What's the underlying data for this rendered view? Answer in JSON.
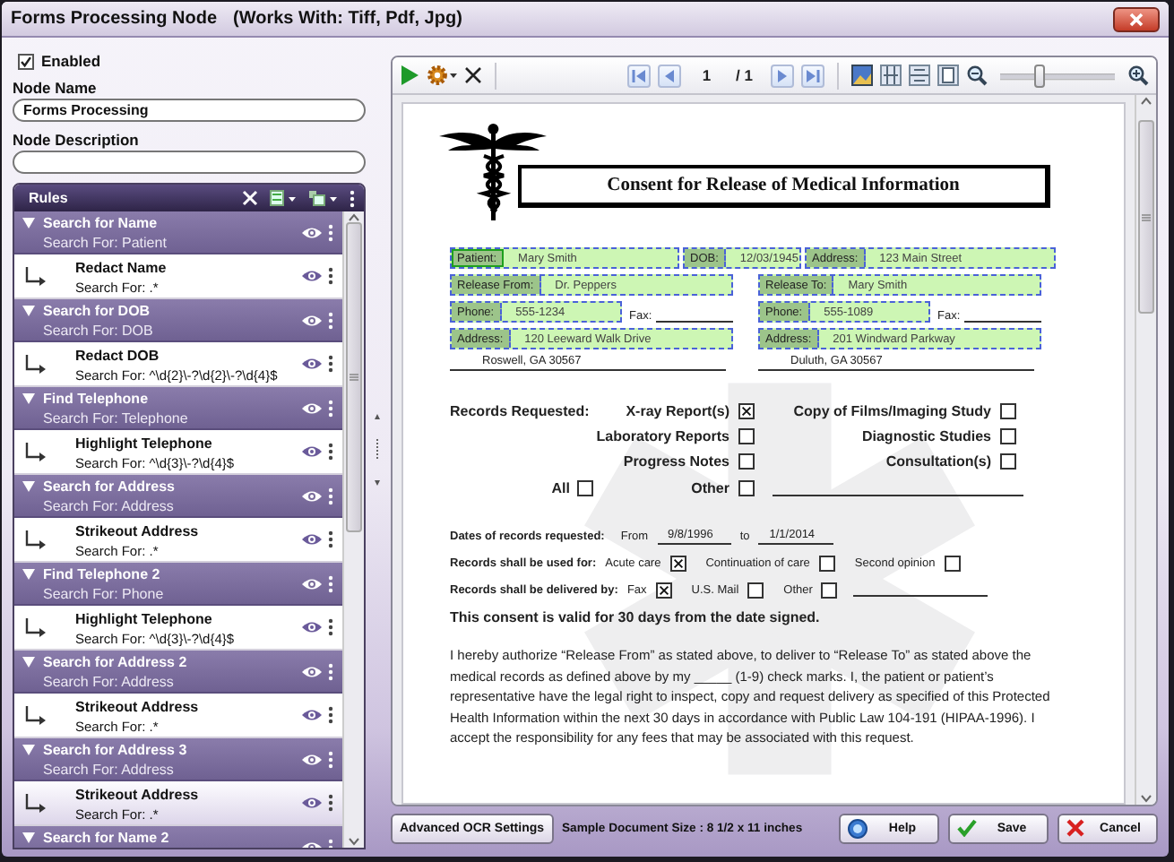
{
  "window": {
    "title": "Forms Processing Node",
    "subtitle": "(Works With: Tiff, Pdf, Jpg)"
  },
  "enabled": {
    "label": "Enabled",
    "checked": true
  },
  "node_name": {
    "label": "Node Name",
    "value": "Forms Processing"
  },
  "node_description": {
    "label": "Node Description"
  },
  "rules": {
    "title": "Rules",
    "groups": [
      {
        "name": "Search for Name",
        "search_for": "Search For: Patient",
        "expanded": true,
        "children": [
          {
            "name": "Redact Name",
            "search_for": "Search For: .*",
            "selected": false
          }
        ]
      },
      {
        "name": "Search for DOB",
        "search_for": "Search For: DOB",
        "expanded": true,
        "children": [
          {
            "name": "Redact DOB",
            "search_for": "Search For: ^\\d{2}\\-?\\d{2}\\-?\\d{4}$",
            "selected": false
          }
        ]
      },
      {
        "name": "Find Telephone",
        "search_for": "Search For: Telephone",
        "expanded": true,
        "children": [
          {
            "name": "Highlight Telephone",
            "search_for": "Search For: ^\\d{3}\\-?\\d{4}$",
            "selected": false
          }
        ]
      },
      {
        "name": "Search for Address",
        "search_for": "Search For: Address",
        "expanded": true,
        "children": [
          {
            "name": "Strikeout Address",
            "search_for": "Search For: .*",
            "selected": false
          }
        ]
      },
      {
        "name": "Find Telephone 2",
        "search_for": "Search For: Phone",
        "expanded": true,
        "children": [
          {
            "name": "Highlight Telephone",
            "search_for": "Search For: ^\\d{3}\\-?\\d{4}$",
            "selected": false
          }
        ]
      },
      {
        "name": "Search for Address 2",
        "search_for": "Search For: Address",
        "expanded": true,
        "children": [
          {
            "name": "Strikeout Address",
            "search_for": "Search For: .*",
            "selected": false
          }
        ]
      },
      {
        "name": "Search for Address 3",
        "search_for": "Search For: Address",
        "expanded": true,
        "children": [
          {
            "name": "Strikeout Address",
            "search_for": "Search For: .*",
            "selected": true
          }
        ]
      },
      {
        "name": "Search for Name 2",
        "expanded": true
      }
    ]
  },
  "viewer": {
    "page": "1",
    "page_total": "/ 1",
    "zoom": {
      "level": 0.3
    }
  },
  "document": {
    "title": "Consent for Release of Medical Information",
    "field_rows": [
      {
        "kind": "single",
        "cells": [
          {
            "kind": "field",
            "label": "Patient:",
            "value": "Mary Smith",
            "selected": true
          },
          {
            "kind": "field",
            "label": "DOB:",
            "value": "12/03/1945",
            "selected": false
          },
          {
            "kind": "field",
            "label": "Address:",
            "value": "123 Main Street",
            "selected": false
          }
        ]
      },
      {
        "kind": "split",
        "left": [
          {
            "kind": "field",
            "label": "Release From:",
            "value": "Dr. Peppers",
            "selected": false
          }
        ],
        "right": [
          {
            "kind": "field",
            "label": "Release To:",
            "value": "Mary Smith",
            "selected": false
          }
        ]
      },
      {
        "kind": "split",
        "left": [
          {
            "kind": "field",
            "label": "Phone:",
            "value": "555-1234",
            "selected": false
          },
          {
            "kind": "blank",
            "label": "Fax:"
          }
        ],
        "right": [
          {
            "kind": "field",
            "label": "Phone:",
            "value": "555-1089",
            "selected": false
          },
          {
            "kind": "blank",
            "label": "Fax:"
          }
        ]
      },
      {
        "kind": "split",
        "left": [
          {
            "kind": "field",
            "label": "Address:",
            "value": "120 Leeward Walk Drive",
            "selected": false
          }
        ],
        "right": [
          {
            "kind": "field",
            "label": "Address:",
            "value": "201 Windward Parkway",
            "selected": false
          }
        ]
      },
      {
        "kind": "split",
        "left": [
          {
            "kind": "line",
            "value": "Roswell, GA 30567"
          }
        ],
        "right": [
          {
            "kind": "line",
            "value": "Duluth, GA 30567"
          }
        ]
      }
    ],
    "records": {
      "label": "Records Requested:",
      "left": [
        {
          "label": "X-ray Report(s)",
          "checked": true
        },
        {
          "label": "Laboratory Reports",
          "checked": false
        },
        {
          "label": "Progress Notes",
          "checked": false
        },
        {
          "label": "Other",
          "checked": false
        }
      ],
      "all": {
        "label": "All",
        "checked": false
      },
      "right": [
        {
          "label": "Copy of Films/Imaging Study",
          "checked": false
        },
        {
          "label": "Diagnostic Studies",
          "checked": false
        },
        {
          "label": "Consultation(s)",
          "checked": false
        }
      ]
    },
    "dates": {
      "label": "Dates of records requested:",
      "from_label": "From",
      "from": "9/8/1996",
      "to_label": "to",
      "to": "1/1/2014"
    },
    "used_for": {
      "label": "Records shall be used for:",
      "options": [
        {
          "label": "Acute care",
          "checked": true
        },
        {
          "label": "Continuation of care",
          "checked": false
        },
        {
          "label": "Second opinion",
          "checked": false
        }
      ]
    },
    "delivered_by": {
      "label": "Records shall be delivered by:",
      "options": [
        {
          "label": "Fax",
          "checked": true
        },
        {
          "label": "U.S. Mail",
          "checked": false
        },
        {
          "label": "Other",
          "checked": false
        }
      ]
    },
    "consent": "This consent is valid for 30 days from the date signed.",
    "paragraph": "I hereby authorize  “Release From” as stated above,  to deliver to  “Release To” as stated above the medical records as defined above by my _____ (1-9) check marks.  I, the patient or patient’s representative have the legal right to inspect, copy and request delivery as specified of this Protected Health Information within the next 30 days in accordance with Public Law 104-191 (HIPAA-1996).  I accept the responsibility for any fees that may be associated with this request."
  },
  "footer": {
    "advanced_button": "Advanced OCR Settings",
    "size_text": "Sample Document Size : 8 1/2 x 11 inches",
    "buttons": [
      {
        "label": "Help",
        "kind": "help"
      },
      {
        "label": "Save",
        "kind": "save"
      },
      {
        "label": "Cancel",
        "kind": "cancel"
      }
    ]
  }
}
